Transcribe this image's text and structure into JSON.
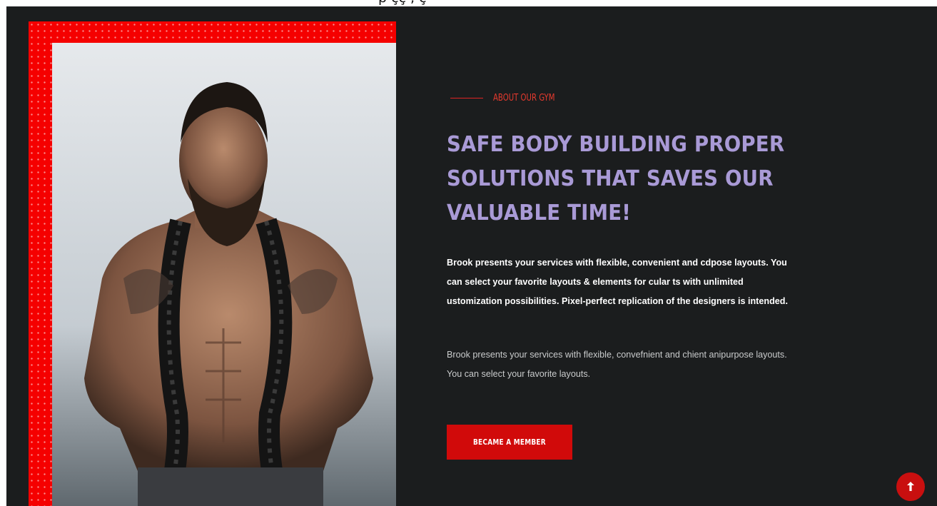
{
  "top_strip": {
    "text": "p çç , ç"
  },
  "about": {
    "subtitle": "ABOUT OUR GYM",
    "heading": "SAFE BODY BUILDING PROPER SOLUTIONS THAT SAVES OUR VALUABLE TIME!",
    "paragraph_1": "Brook presents your services with flexible, convenient and cdpose layouts. You can select your favorite layouts & elements for cular ts with unlimited ustomization possibilities. Pixel-perfect replication of the designers is intended.",
    "paragraph_2": "Brook presents your services with flexible, convefnient and chient anipurpose layouts. You can select your favorite layouts.",
    "cta_label": "BECAME A MEMBER"
  },
  "colors": {
    "background": "#1b1d1e",
    "accent_red": "#d10a0a",
    "heading_lavender": "#a99ad6"
  },
  "icons": {
    "scroll_top": "arrow-up-icon"
  }
}
